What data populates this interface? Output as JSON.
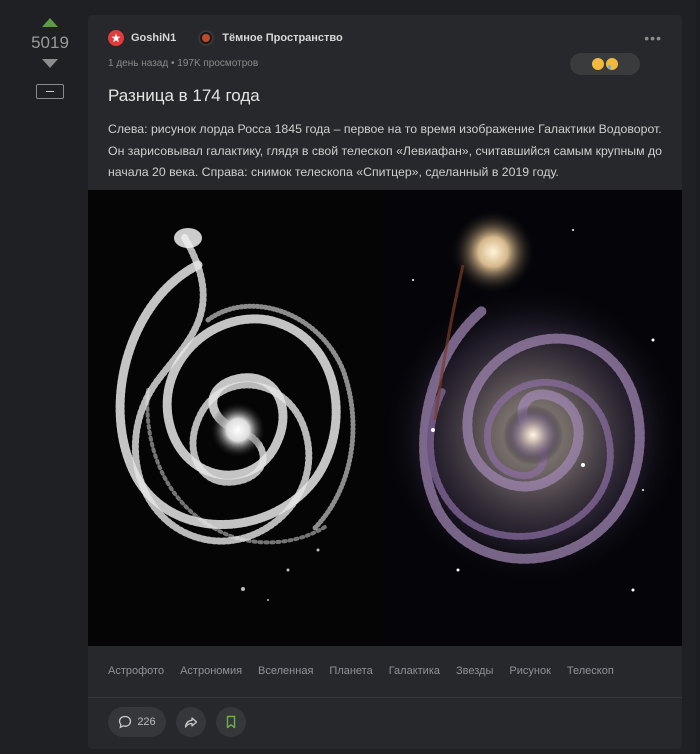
{
  "rating": {
    "score": "5019"
  },
  "post": {
    "author": "GoshiN1",
    "community": "Тёмное Пространство",
    "meta": "1 день назад • 197K просмотров",
    "title": "Разница в 174 года",
    "text": "Слева: рисунок лорда Росса 1845 года – первое на то время изображение Галактики Водоворот. Он зарисовывал галактику, глядя в свой телескоп «Левиафан», считавшийся самым крупным до начала 20 века. Справа: снимок телескопа «Спитцер», сделанный в 2019 году.",
    "more_label": "•••",
    "tags": [
      "Астрофото",
      "Астрономия",
      "Вселенная",
      "Планета",
      "Галактика",
      "Звезды",
      "Рисунок",
      "Телескоп"
    ],
    "comments_count": "226"
  },
  "colors": {
    "background": "#1e2023",
    "card": "#26282b",
    "upvote": "#5d9b42",
    "author_badge": "#e23b3b"
  },
  "icons": {
    "author": "star-badge-icon",
    "community": "nebula-icon",
    "upvote": "arrow-up-icon",
    "downvote": "arrow-down-icon",
    "more": "more-dots-icon",
    "comments": "comment-bubble-icon",
    "share": "share-icon",
    "save": "bookmark-icon"
  }
}
